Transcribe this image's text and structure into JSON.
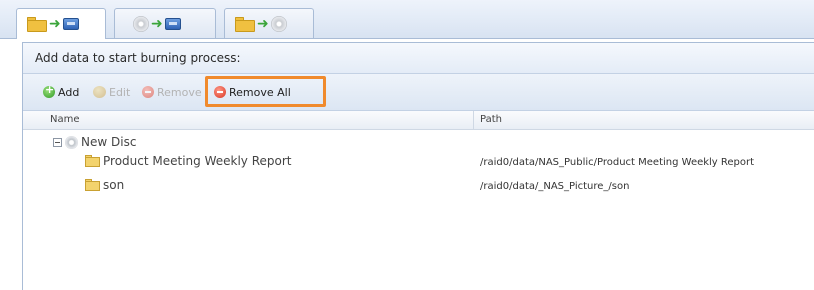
{
  "tabs": [
    {
      "icons": [
        "folder-icon",
        "arrow-right-icon",
        "disk-icon"
      ],
      "active": true
    },
    {
      "icons": [
        "cd-icon",
        "arrow-right-icon",
        "disk-icon"
      ],
      "active": false
    },
    {
      "icons": [
        "folder-icon",
        "arrow-right-icon",
        "cd-icon"
      ],
      "active": false
    }
  ],
  "panel": {
    "title": "Add data to start burning process:"
  },
  "toolbar": {
    "add_label": "Add",
    "edit_label": "Edit",
    "remove_label": "Remove",
    "remove_all_label": "Remove All",
    "highlight_color": "#f08a2c"
  },
  "grid": {
    "columns": [
      "Name",
      "Path"
    ],
    "root": {
      "name": "New Disc",
      "expanded": true
    },
    "rows": [
      {
        "name": "Product Meeting Weekly Report",
        "path": "/raid0/data/NAS_Public/Product Meeting Weekly Report"
      },
      {
        "name": "son",
        "path": "/raid0/data/_NAS_Picture_/son"
      }
    ]
  }
}
